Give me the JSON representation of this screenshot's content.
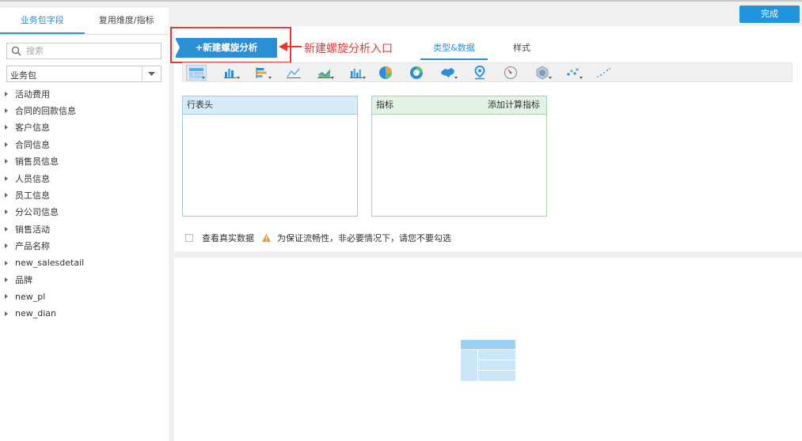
{
  "left_panel": {
    "tabs": [
      {
        "label": "业务包字段",
        "active": true
      },
      {
        "label": "复用维度/指标",
        "active": false
      }
    ],
    "search": {
      "placeholder": "搜索",
      "value": ""
    },
    "package_select": {
      "value": "业务包"
    },
    "tree_items": [
      "活动费用",
      "合同的回款信息",
      "客户信息",
      "合同信息",
      "销售员信息",
      "人员信息",
      "员工信息",
      "分公司信息",
      "销售活动",
      "产品名称",
      "new_salesdetail",
      "品牌",
      "new_pl",
      "new_dian"
    ]
  },
  "header": {
    "done_label": "完成"
  },
  "new_spiral_button": {
    "label": "+新建螺旋分析"
  },
  "annotation": {
    "text": "新建螺旋分析入口",
    "color": "#e53935"
  },
  "right_tabs": [
    {
      "label": "类型&数据",
      "active": true
    },
    {
      "label": "样式",
      "active": false
    }
  ],
  "chart_types": [
    "table-icon",
    "bar-chart-icon",
    "stacked-bar-icon",
    "line-chart-icon",
    "area-chart-icon",
    "combo-chart-icon",
    "pie-chart-icon",
    "donut-chart-icon",
    "china-map-icon",
    "gis-map-icon",
    "gauge-icon",
    "radar-icon",
    "scatter-icon",
    "bubble-icon"
  ],
  "row_header_box": {
    "title": "行表头"
  },
  "measure_box": {
    "title": "指标",
    "add_label": "添加计算指标"
  },
  "realdata": {
    "checkbox_label": "查看真实数据",
    "warning_text": "为保证流畅性，非必要情况下，请您不要勾选",
    "checked": false
  },
  "colors": {
    "accent": "#2b8fd6",
    "done_button": "#2094dc",
    "row_box_header": "#d6edf9",
    "measure_box_header": "#e2f2e4",
    "warning": "#f39c12"
  }
}
